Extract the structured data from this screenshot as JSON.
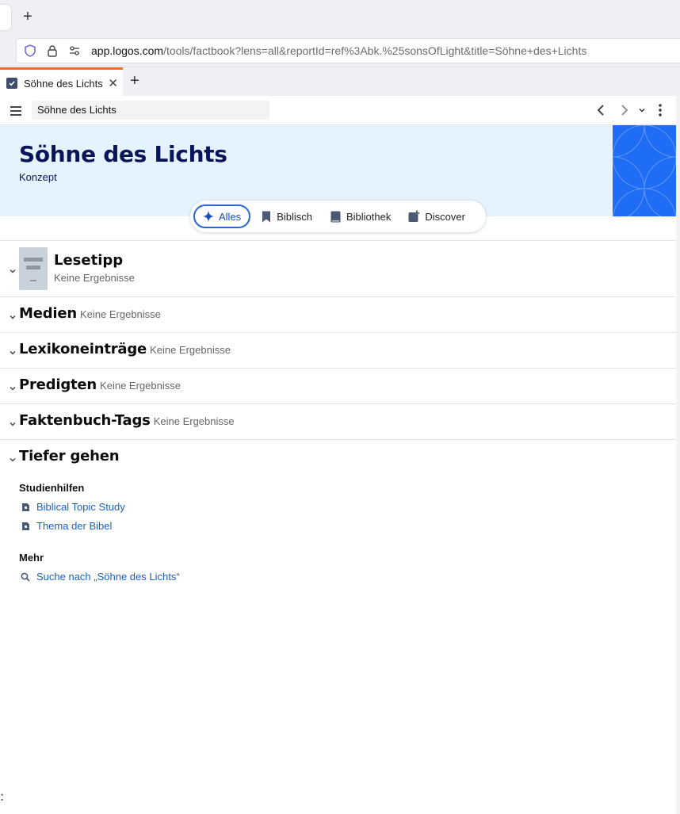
{
  "browser": {
    "url_host": "app.logos.com",
    "url_path": "/tools/factbook?lens=all&reportId=ref%3Abk.%25sonsOfLight&title=Söhne+des+Lichts",
    "tab_title": "Söhne des Lichts"
  },
  "toolbar": {
    "search_value": "Söhne des Lichts"
  },
  "banner": {
    "title": "Söhne des Lichts",
    "subtitle": "Konzept"
  },
  "filters": [
    {
      "label": "Alles",
      "icon": "sparkle-icon",
      "active": true
    },
    {
      "label": "Biblisch",
      "icon": "bookmark-icon",
      "active": false
    },
    {
      "label": "Bibliothek",
      "icon": "book-icon",
      "active": false
    },
    {
      "label": "Discover",
      "icon": "discover-icon",
      "active": false
    }
  ],
  "sections": {
    "lesetipp": {
      "title": "Lesetipp",
      "note": "Keine Ergebnisse"
    },
    "medien": {
      "title": "Medien",
      "note": "Keine Ergebnisse"
    },
    "lexikon": {
      "title": "Lexikoneinträge",
      "note": "Keine Ergebnisse"
    },
    "predigten": {
      "title": "Predigten",
      "note": "Keine Ergebnisse"
    },
    "faktenbuch": {
      "title": "Faktenbuch-Tags",
      "note": "Keine Ergebnisse"
    },
    "tiefer": {
      "title": "Tiefer gehen",
      "studienhilfen_heading": "Studienhilfen",
      "studienhilfen": [
        {
          "label": "Biblical Topic Study"
        },
        {
          "label": "Thema der Bibel"
        }
      ],
      "mehr_heading": "Mehr",
      "mehr": [
        {
          "label": "Suche nach „Söhne des Lichts“"
        }
      ]
    }
  },
  "colors": {
    "banner_bg": "#e4f3fd",
    "title_color": "#0a1559",
    "accent": "#2767d8",
    "link": "#1a5fc8",
    "tab_accent": "#f36f21"
  }
}
